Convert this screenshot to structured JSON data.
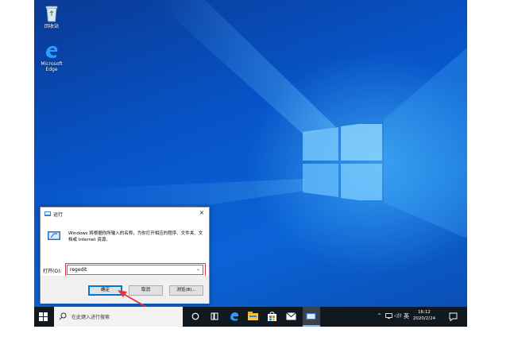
{
  "desktop": {
    "icons": [
      {
        "label": "回收站",
        "icon": "recycle-bin-icon"
      },
      {
        "label": "Microsoft Edge",
        "icon": "edge-icon"
      }
    ]
  },
  "run_dialog": {
    "title": "运行",
    "close_glyph": "×",
    "description": "Windows 将根据你所输入的名称，为你打开相应的程序、文件夹、文档或 Internet 资源。",
    "open_label": "打开(O):",
    "input_value": "regedit",
    "dropdown_glyph": "⌄",
    "buttons": {
      "ok": "确定",
      "cancel": "取消",
      "browse": "浏览(B)..."
    }
  },
  "taskbar": {
    "search_placeholder": "在此键入进行搜索",
    "tray": {
      "chevron": "^",
      "volume": "◁))",
      "ime": "英",
      "time": "16:12",
      "date": "2020/2/24"
    }
  },
  "colors": {
    "accent": "#0078d7",
    "highlight": "#e0353b",
    "taskbar": "#101820"
  }
}
